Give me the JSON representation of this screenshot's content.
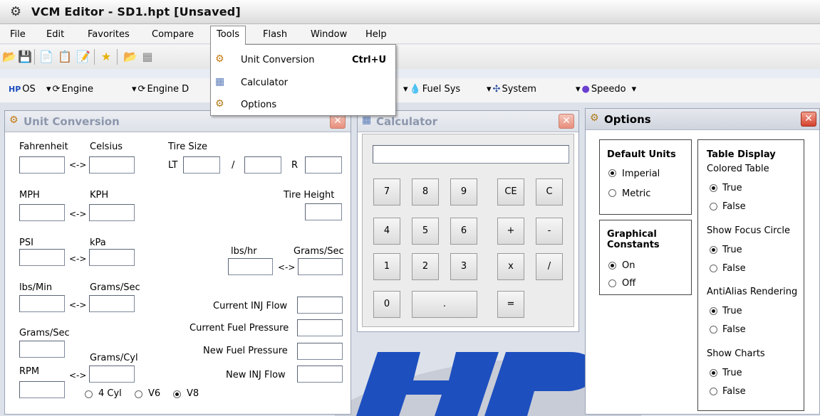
{
  "app": {
    "title": "VCM Editor - SD1.hpt    [Unsaved]"
  },
  "menubar": [
    "File",
    "Edit",
    "Favorites",
    "Compare",
    "Tools",
    "Flash",
    "Window",
    "Help"
  ],
  "tools_menu": [
    {
      "label": "Unit Conversion",
      "shortcut": "Ctrl+U",
      "icon": "unit-conversion-icon"
    },
    {
      "label": "Calculator",
      "shortcut": "",
      "icon": "calculator-icon"
    },
    {
      "label": "Options",
      "shortcut": "",
      "icon": "options-icon"
    }
  ],
  "modules": [
    "OS",
    "Engine",
    "Engine D",
    "Fuel Sys",
    "System",
    "Speedo"
  ],
  "unit_conversion": {
    "title": "Unit Conversion",
    "fahrenheit": "Fahrenheit",
    "celsius": "Celsius",
    "tire_size": "Tire Size",
    "lt": "LT",
    "slash": "/",
    "r": "R",
    "mph": "MPH",
    "kph": "KPH",
    "tire_height": "Tire Height",
    "psi": "PSI",
    "kpa": "kPa",
    "lbs_hr": "lbs/hr",
    "grams_sec": "Grams/Sec",
    "lbs_min": "lbs/Min",
    "grams_sec2": "Grams/Sec",
    "current_inj_flow": "Current INJ Flow",
    "current_fuel_pressure": "Current Fuel Pressure",
    "grams_sec3": "Grams/Sec",
    "new_fuel_pressure": "New Fuel Pressure",
    "grams_cyl": "Grams/Cyl",
    "rpm": "RPM",
    "new_inj_flow": "New INJ Flow",
    "arrow": "<->",
    "cylinders": [
      {
        "label": "4 Cyl",
        "selected": false
      },
      {
        "label": "V6",
        "selected": false
      },
      {
        "label": "V8",
        "selected": true
      }
    ]
  },
  "calculator": {
    "title": "Calculator",
    "display": "",
    "keys": [
      "7",
      "8",
      "9",
      "CE",
      "C",
      "4",
      "5",
      "6",
      "+",
      "-",
      "1",
      "2",
      "3",
      "x",
      "/",
      "0",
      ".",
      "="
    ]
  },
  "options": {
    "title": "Options",
    "default_units": {
      "title": "Default Units",
      "options": [
        {
          "label": "Imperial",
          "selected": true
        },
        {
          "label": "Metric",
          "selected": false
        }
      ]
    },
    "graphical_constants": {
      "title": "Graphical Constants",
      "options": [
        {
          "label": "On",
          "selected": true
        },
        {
          "label": "Off",
          "selected": false
        }
      ]
    },
    "table_display": {
      "title": "Table Display",
      "groups": [
        {
          "label": "Colored Table",
          "options": [
            {
              "label": "True",
              "selected": true
            },
            {
              "label": "False",
              "selected": false
            }
          ]
        },
        {
          "label": "Show Focus Circle",
          "options": [
            {
              "label": "True",
              "selected": true
            },
            {
              "label": "False",
              "selected": false
            }
          ]
        },
        {
          "label": "AntiAlias Rendering",
          "options": [
            {
              "label": "True",
              "selected": true
            },
            {
              "label": "False",
              "selected": false
            }
          ]
        },
        {
          "label": "Show Charts",
          "options": [
            {
              "label": "True",
              "selected": true
            },
            {
              "label": "False",
              "selected": false
            }
          ]
        }
      ]
    }
  },
  "colors": {
    "close": "#d4432d",
    "accent": "#1d4fbf"
  }
}
